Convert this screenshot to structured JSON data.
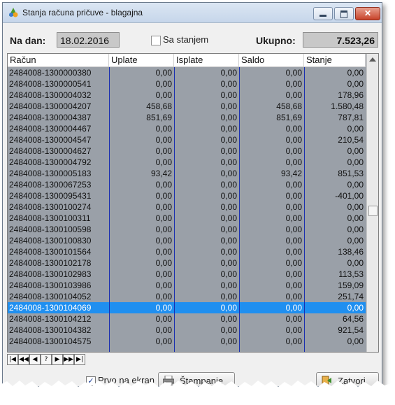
{
  "window": {
    "title": "Stanja računa pričuve - blagajna"
  },
  "filters": {
    "date_label": "Na dan:",
    "date_value": "18.02.2016",
    "with_balance_label": "Sa stanjem",
    "total_label": "Ukupno:",
    "total_value": "7.523,26"
  },
  "grid": {
    "columns": [
      "Račun",
      "Uplate",
      "Isplate",
      "Saldo",
      "Stanje"
    ],
    "selected_index": 21,
    "rows": [
      [
        "2484008-1300000380",
        "0,00",
        "0,00",
        "0,00",
        "0,00"
      ],
      [
        "2484008-1300000541",
        "0,00",
        "0,00",
        "0,00",
        "0,00"
      ],
      [
        "2484008-1300004032",
        "0,00",
        "0,00",
        "0,00",
        "178,96"
      ],
      [
        "2484008-1300004207",
        "458,68",
        "0,00",
        "458,68",
        "1.580,48"
      ],
      [
        "2484008-1300004387",
        "851,69",
        "0,00",
        "851,69",
        "787,81"
      ],
      [
        "2484008-1300004467",
        "0,00",
        "0,00",
        "0,00",
        "0,00"
      ],
      [
        "2484008-1300004547",
        "0,00",
        "0,00",
        "0,00",
        "210,54"
      ],
      [
        "2484008-1300004627",
        "0,00",
        "0,00",
        "0,00",
        "0,00"
      ],
      [
        "2484008-1300004792",
        "0,00",
        "0,00",
        "0,00",
        "0,00"
      ],
      [
        "2484008-1300005183",
        "93,42",
        "0,00",
        "93,42",
        "851,53"
      ],
      [
        "2484008-1300067253",
        "0,00",
        "0,00",
        "0,00",
        "0,00"
      ],
      [
        "2484008-1300095431",
        "0,00",
        "0,00",
        "0,00",
        "-401,00"
      ],
      [
        "2484008-1300100274",
        "0,00",
        "0,00",
        "0,00",
        "0,00"
      ],
      [
        "2484008-1300100311",
        "0,00",
        "0,00",
        "0,00",
        "0,00"
      ],
      [
        "2484008-1300100598",
        "0,00",
        "0,00",
        "0,00",
        "0,00"
      ],
      [
        "2484008-1300100830",
        "0,00",
        "0,00",
        "0,00",
        "0,00"
      ],
      [
        "2484008-1300101564",
        "0,00",
        "0,00",
        "0,00",
        "138,46"
      ],
      [
        "2484008-1300102178",
        "0,00",
        "0,00",
        "0,00",
        "0,00"
      ],
      [
        "2484008-1300102983",
        "0,00",
        "0,00",
        "0,00",
        "113,53"
      ],
      [
        "2484008-1300103986",
        "0,00",
        "0,00",
        "0,00",
        "159,09"
      ],
      [
        "2484008-1300104052",
        "0,00",
        "0,00",
        "0,00",
        "251,74"
      ],
      [
        "2484008-1300104069",
        "0,00",
        "0,00",
        "0,00",
        "0,00"
      ],
      [
        "2484008-1300104212",
        "0,00",
        "0,00",
        "0,00",
        "64,56"
      ],
      [
        "2484008-1300104382",
        "0,00",
        "0,00",
        "0,00",
        "921,54"
      ],
      [
        "2484008-1300104575",
        "0,00",
        "0,00",
        "0,00",
        "0,00"
      ]
    ]
  },
  "navigator": {
    "buttons": [
      {
        "name": "nav-first-button",
        "glyph": "|◀"
      },
      {
        "name": "nav-prior-page-button",
        "glyph": "◀◀"
      },
      {
        "name": "nav-prior-button",
        "glyph": "◀"
      },
      {
        "name": "nav-help-button",
        "glyph": "?"
      },
      {
        "name": "nav-next-button",
        "glyph": "▶"
      },
      {
        "name": "nav-next-page-button",
        "glyph": "▶▶"
      },
      {
        "name": "nav-last-button",
        "glyph": "▶|"
      }
    ]
  },
  "footer": {
    "screen_label": "Prvo na ekran",
    "print_label": "Štampanje",
    "close_label": "Zatvori"
  },
  "colors": {
    "selected_row": "#1f8ff0",
    "grid_bg": "#9aa0a8",
    "column_lines": "#1a2fb0"
  }
}
